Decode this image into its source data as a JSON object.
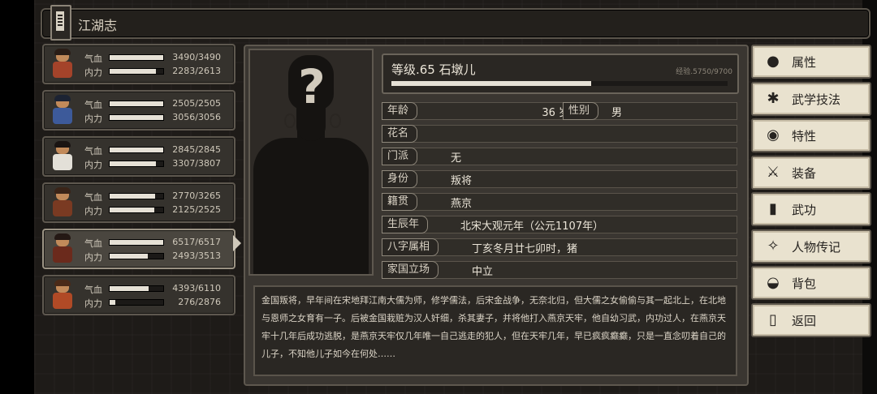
{
  "title": "江湖志",
  "party": [
    {
      "hp_label": "气血",
      "hp": "3490/3490",
      "hp_pct": 1.0,
      "mp_label": "内力",
      "mp": "2283/2613",
      "mp_pct": 0.87,
      "colors": {
        "body": "#a4432a",
        "hair": "#2a1d16"
      }
    },
    {
      "hp_label": "气血",
      "hp": "2505/2505",
      "hp_pct": 1.0,
      "mp_label": "内力",
      "mp": "3056/3056",
      "mp_pct": 1.0,
      "colors": {
        "body": "#3d5a9a",
        "hair": "#1c2333"
      }
    },
    {
      "hp_label": "气血",
      "hp": "2845/2845",
      "hp_pct": 1.0,
      "mp_label": "内力",
      "mp": "3307/3807",
      "mp_pct": 0.87,
      "colors": {
        "body": "#e3e0d8",
        "hair": "#1a1412"
      }
    },
    {
      "hp_label": "气血",
      "hp": "2770/3265",
      "hp_pct": 0.85,
      "mp_label": "内力",
      "mp": "2125/2525",
      "mp_pct": 0.84,
      "colors": {
        "body": "#7a3a22",
        "hair": "#3a2418"
      }
    },
    {
      "hp_label": "气血",
      "hp": "6517/6517",
      "hp_pct": 1.0,
      "mp_label": "内力",
      "mp": "2493/3513",
      "mp_pct": 0.71,
      "colors": {
        "body": "#6b2a1c",
        "hair": "#241814"
      }
    },
    {
      "hp_label": "气血",
      "hp": "4393/6110",
      "hp_pct": 0.72,
      "mp_label": "内力",
      "mp": "276/2876",
      "mp_pct": 0.1,
      "colors": {
        "body": "#b04a26",
        "hair": "#4a2a18"
      }
    }
  ],
  "character": {
    "level_line": "等级.65 石墩儿",
    "exp_text": "经验.5750/9700",
    "exp_pct": 0.593,
    "rows": [
      {
        "label": "年龄",
        "value": "36 岁",
        "label2": "性别",
        "value2": "男"
      },
      {
        "label": "花名",
        "value": ""
      },
      {
        "label": "门派",
        "value": "无"
      },
      {
        "label": "身份",
        "value": "叛将"
      },
      {
        "label": "籍贯",
        "value": "燕京"
      },
      {
        "label": "生辰年",
        "value": "北宋大观元年（公元1107年）"
      },
      {
        "label": "八字属相",
        "value": "丁亥冬月廿七卯时，猪"
      },
      {
        "label": "家国立场",
        "value": "中立"
      }
    ],
    "bio": "金国叛将，早年间在宋地拜江南大儒为师，修学儒法，后宋金战争，无奈北归，但大儒之女偷偷与其一起北上，在北地与恩师之女育有一子。后被金国栽赃为汉人奸细，杀其妻子，并将他打入燕京天牢，他自幼习武，内功过人，在燕京天牢十几年后成功逃脱，是燕京天牢仅几年唯一自己逃走的犯人，但在天牢几年，早已疯疯癫癫，只是一直念叨着自己的儿子，不知他儿子如今在何处……"
  },
  "menu": [
    {
      "label": "属性",
      "icon": "person-icon"
    },
    {
      "label": "武学技法",
      "icon": "martial-skill-icon"
    },
    {
      "label": "特性",
      "icon": "trait-icon"
    },
    {
      "label": "装备",
      "icon": "sword-icon"
    },
    {
      "label": "武功",
      "icon": "book-icon"
    },
    {
      "label": "人物传记",
      "icon": "biography-icon"
    },
    {
      "label": "背包",
      "icon": "bag-icon"
    },
    {
      "label": "返回",
      "icon": "door-icon"
    }
  ]
}
